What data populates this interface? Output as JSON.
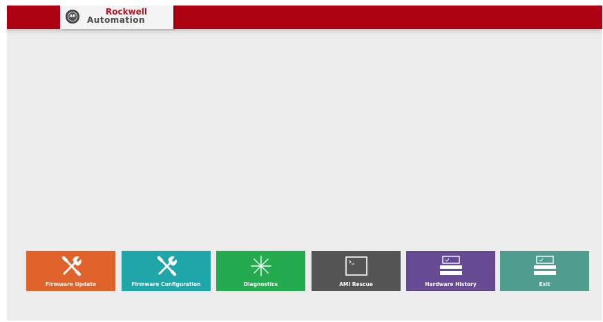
{
  "brand": {
    "line1": "Rockwell",
    "line2": "Automation",
    "seal": "AB"
  },
  "colors": {
    "top_bar": "#ad0013",
    "background": "#ececec",
    "tile_firmware_update": "#e0622b",
    "tile_firmware_configuration": "#1fa6a8",
    "tile_diagnostics": "#25ab4f",
    "tile_ami_rescue": "#555555",
    "tile_hardware_history": "#674b92",
    "tile_exit": "#509c8e"
  },
  "tiles": [
    {
      "label": "Firmware Update",
      "icon": "tools-icon"
    },
    {
      "label": "Firmware Configuration",
      "icon": "tools-icon"
    },
    {
      "label": "Diagnostics",
      "icon": "starburst-icon"
    },
    {
      "label": "AMI Rescue",
      "icon": "terminal-icon"
    },
    {
      "label": "Hardware History",
      "icon": "checklist-icon"
    },
    {
      "label": "Exit",
      "icon": "checklist-icon"
    }
  ]
}
